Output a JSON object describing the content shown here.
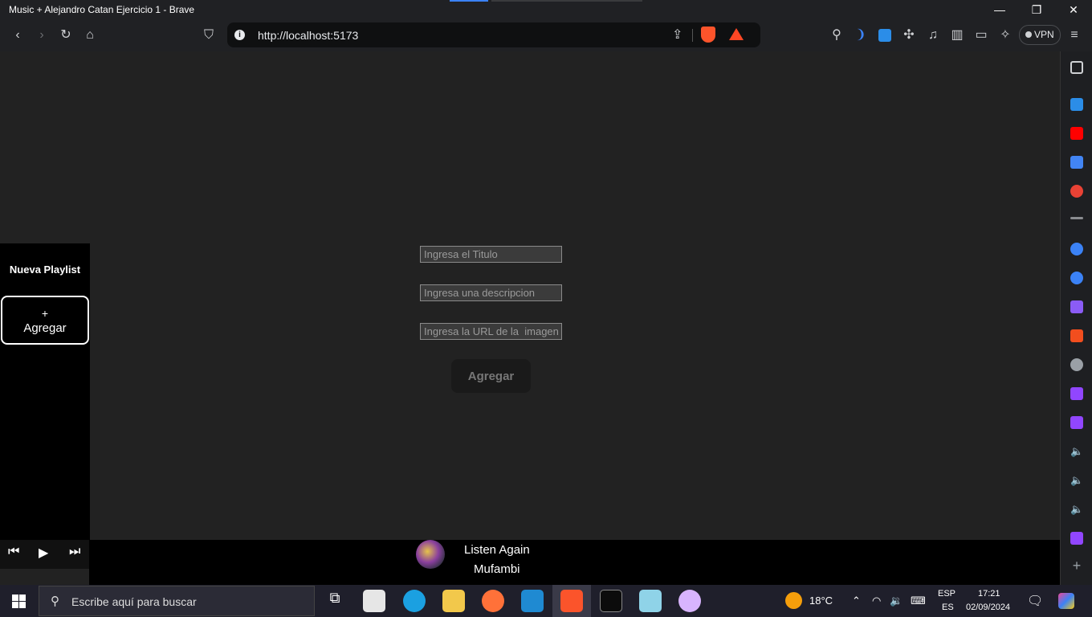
{
  "window": {
    "title": "Music + Alejandro Catan Ejercicio 1 - Brave",
    "controls": {
      "minimize": "—",
      "maximize": "❐",
      "close": "✕"
    }
  },
  "toolbar": {
    "url": "http://localhost:5173",
    "vpn_label": "VPN"
  },
  "sidebar": {
    "heading": "Nueva Playlist",
    "add_button": {
      "plus": "+",
      "label": "Agregar"
    }
  },
  "form": {
    "title_placeholder": "Ingresa el Titulo",
    "description_placeholder": "Ingresa una descripcion",
    "image_url_placeholder": "Ingresa la URL de la  imagen",
    "submit_label": "Agregar"
  },
  "player": {
    "now_playing_title": "Listen Again",
    "now_playing_artist": "Mufambi"
  },
  "taskbar": {
    "search_placeholder": "Escribe aquí para buscar",
    "weather_temp": "18°C",
    "language_line1": "ESP",
    "language_line2": "ES",
    "time": "17:21",
    "date": "02/09/2024"
  }
}
